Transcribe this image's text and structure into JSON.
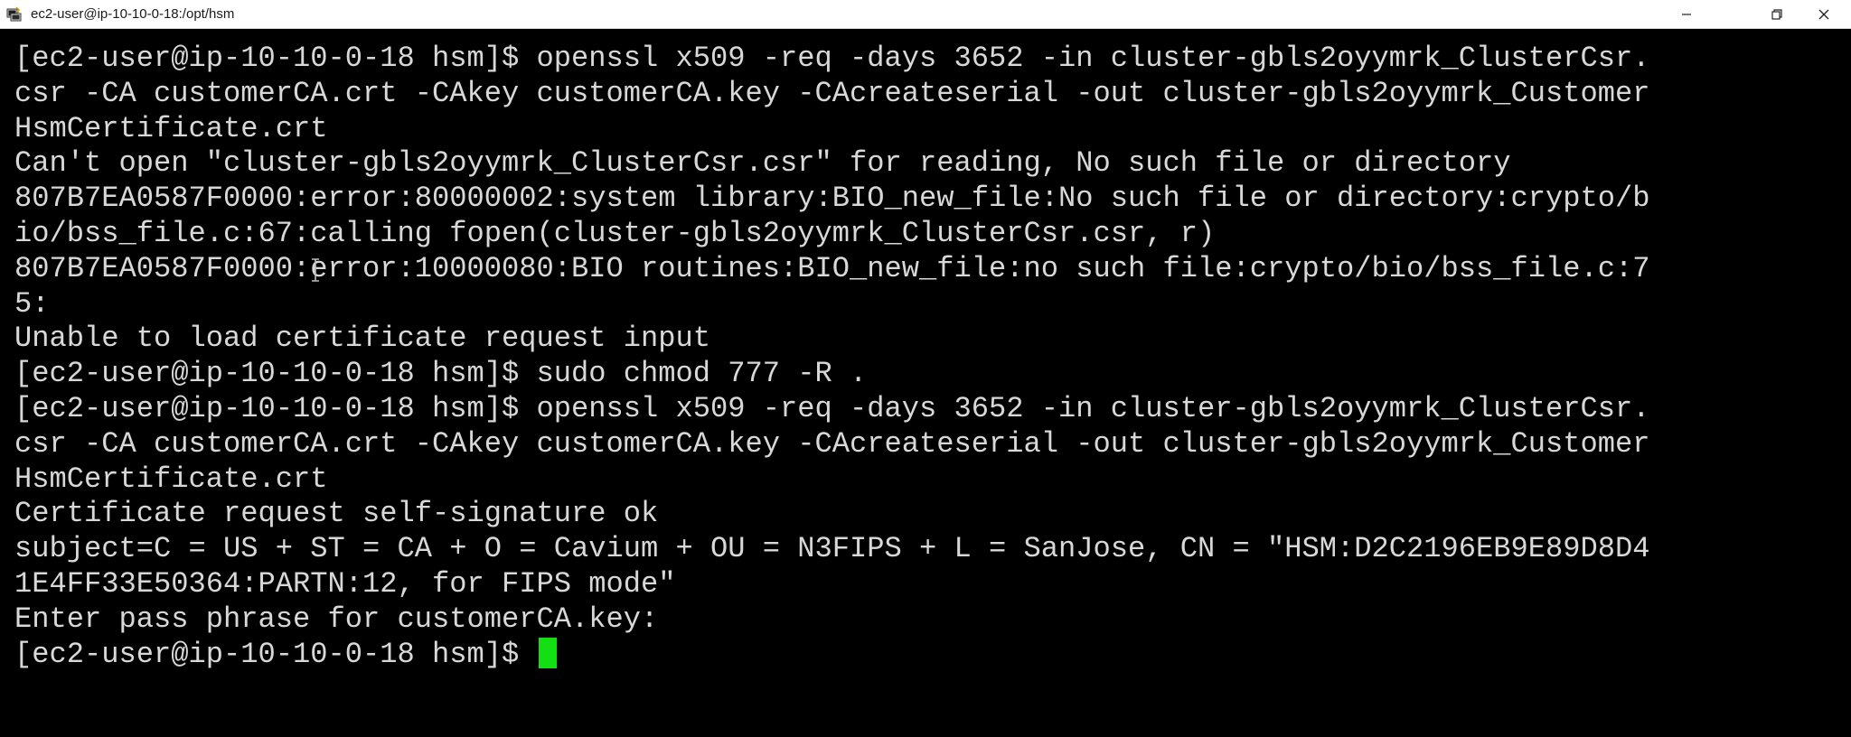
{
  "window": {
    "title": "ec2-user@ip-10-10-0-18:/opt/hsm",
    "icons": {
      "app": "putty-terminal-icon",
      "minimize": "minimize-icon",
      "maximize": "restore-icon",
      "close": "close-icon"
    }
  },
  "terminal": {
    "lines": [
      "[ec2-user@ip-10-10-0-18 hsm]$ openssl x509 -req -days 3652 -in cluster-gbls2oyymrk_ClusterCsr.",
      "csr -CA customerCA.crt -CAkey customerCA.key -CAcreateserial -out cluster-gbls2oyymrk_Customer",
      "HsmCertificate.crt",
      "Can't open \"cluster-gbls2oyymrk_ClusterCsr.csr\" for reading, No such file or directory",
      "807B7EA0587F0000:error:80000002:system library:BIO_new_file:No such file or directory:crypto/b",
      "io/bss_file.c:67:calling fopen(cluster-gbls2oyymrk_ClusterCsr.csr, r)",
      "807B7EA0587F0000:error:10000080:BIO routines:BIO_new_file:no such file:crypto/bio/bss_file.c:7",
      "5:",
      "Unable to load certificate request input",
      "[ec2-user@ip-10-10-0-18 hsm]$ sudo chmod 777 -R .",
      "[ec2-user@ip-10-10-0-18 hsm]$ openssl x509 -req -days 3652 -in cluster-gbls2oyymrk_ClusterCsr.",
      "csr -CA customerCA.crt -CAkey customerCA.key -CAcreateserial -out cluster-gbls2oyymrk_Customer",
      "HsmCertificate.crt",
      "Certificate request self-signature ok",
      "subject=C = US + ST = CA + O = Cavium + OU = N3FIPS + L = SanJose, CN = \"HSM:D2C2196EB9E89D8D4",
      "1E4FF33E50364:PARTN:12, for FIPS mode\"",
      "Enter pass phrase for customerCA.key:"
    ],
    "prompt": "[ec2-user@ip-10-10-0-18 hsm]$ ",
    "cursor_color": "#13e013",
    "text_color": "#d8d8d8",
    "background_color": "#000000"
  }
}
